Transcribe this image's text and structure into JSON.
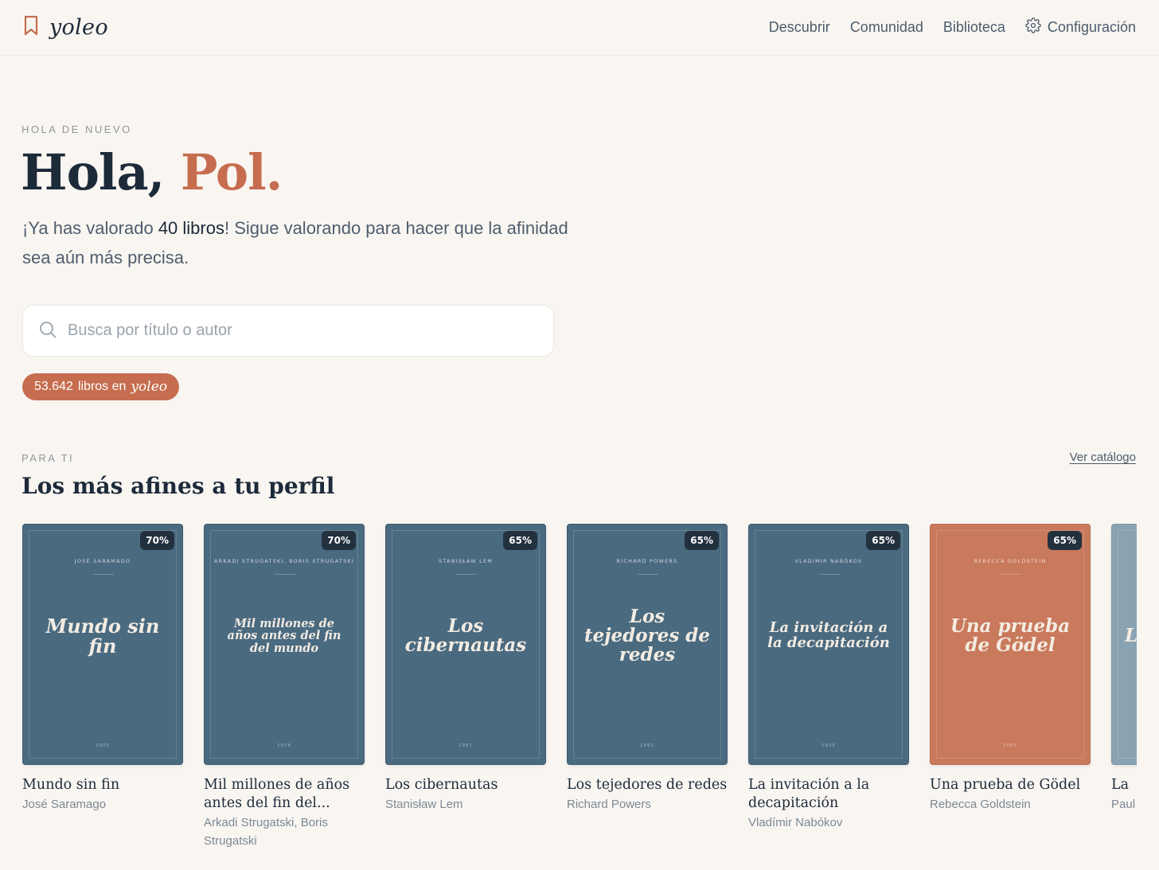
{
  "brand": {
    "name": "yoleo"
  },
  "nav": {
    "items": [
      {
        "label": "Descubrir"
      },
      {
        "label": "Comunidad"
      },
      {
        "label": "Biblioteca"
      },
      {
        "label": "Configuración"
      }
    ]
  },
  "hero": {
    "eyebrow": "HOLA DE NUEVO",
    "greeting": "Hola, ",
    "name": "Pol.",
    "intro_pre": "¡Ya has valorado ",
    "intro_bold": "40 libros",
    "intro_post": "! Sigue valorando para hacer que la afinidad sea aún más precisa."
  },
  "search": {
    "placeholder": "Busca por título o autor",
    "value": ""
  },
  "catalog_pill": {
    "count": "53.642",
    "label": "libros en",
    "brand": "yoleo"
  },
  "section": {
    "eyebrow": "PARA TI",
    "title": "Los más afines a tu perfil",
    "see_all": "Ver catálogo"
  },
  "books": [
    {
      "title": "Mundo sin fin",
      "author": "José Saramago",
      "cover_author": "José Saramago",
      "cover_title": "Mundo sin fin",
      "year": "2005",
      "match": "70%",
      "color": "#4a6a80"
    },
    {
      "title": "Mil millones de años antes del fin del...",
      "author": "Arkadi Strugatski, Boris Strugatski",
      "cover_author": "Arkadi Strugatski, Boris Strugatski",
      "cover_title": "Mil millones de años antes del fin del mundo",
      "year": "1976",
      "match": "70%",
      "color": "#4a6a80"
    },
    {
      "title": "Los cibernautas",
      "author": "Stanisław Lem",
      "cover_author": "Stanisław Lem",
      "cover_title": "Los cibernautas",
      "year": "1967",
      "match": "65%",
      "color": "#4a6a80"
    },
    {
      "title": "Los tejedores de redes",
      "author": "Richard Powers",
      "cover_author": "Richard Powers",
      "cover_title": "Los tejedores de redes",
      "year": "1991",
      "match": "65%",
      "color": "#4a6a80"
    },
    {
      "title": "La invitación a la decapitación",
      "author": "Vladímir Nabókov",
      "cover_author": "Vladímir Nabókov",
      "cover_title": "La invitación a la decapitación",
      "year": "1935",
      "match": "65%",
      "color": "#4a6a80"
    },
    {
      "title": "Una prueba de Gödel",
      "author": "Rebecca Goldstein",
      "cover_author": "Rebecca Goldstein",
      "cover_title": "Una prueba de Gödel",
      "year": "2005",
      "match": "65%",
      "color": "#c9795c"
    },
    {
      "title": "La",
      "author": "Paul",
      "cover_author": "",
      "cover_title": "L",
      "year": "",
      "match": "",
      "color": "#8aa3b3"
    }
  ]
}
